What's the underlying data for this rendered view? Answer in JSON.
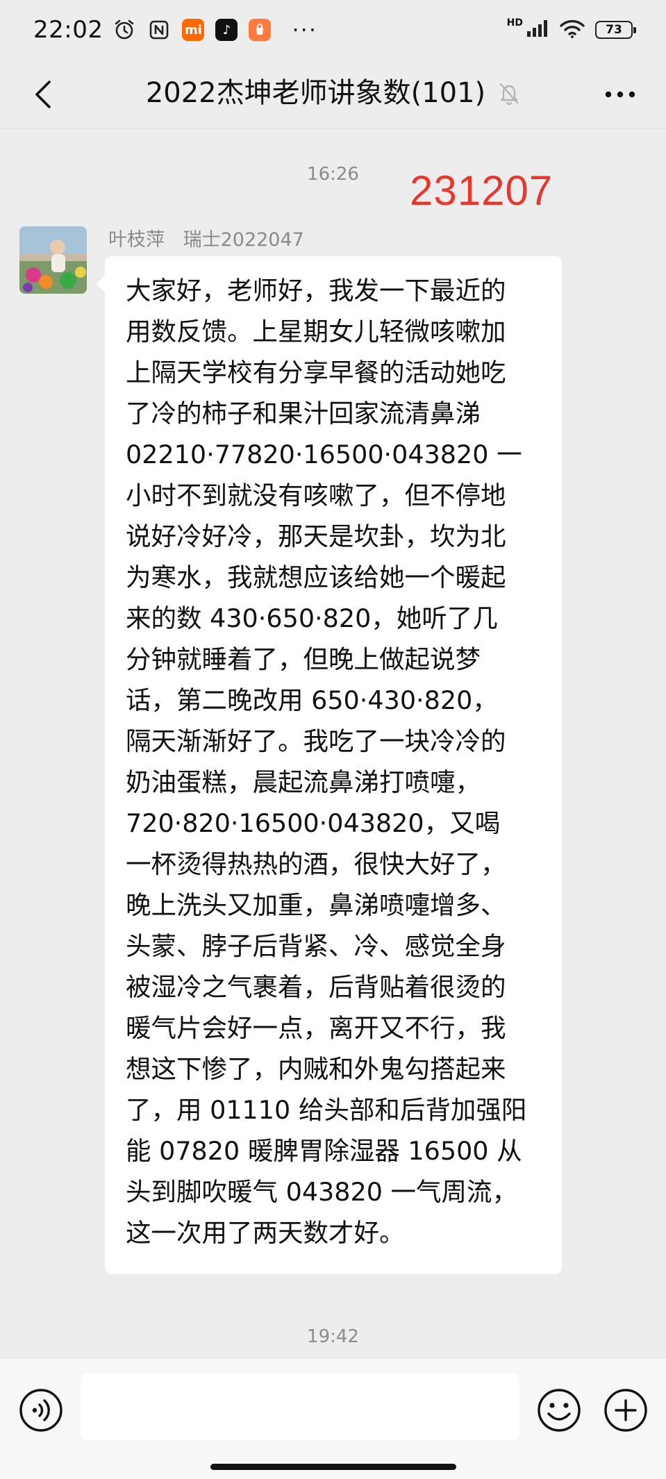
{
  "status_bar": {
    "time": "22:02",
    "app_badges": [
      {
        "name": "mi-app-icon",
        "text": "mi",
        "color": "#ff6900"
      },
      {
        "name": "tiktok-icon",
        "text": "♪",
        "color": "#111111"
      },
      {
        "name": "shopping-bag-icon",
        "text": "",
        "color": "#ff7a3d"
      }
    ],
    "more_dots": "···",
    "network_label": "HD",
    "battery_level": "73"
  },
  "header": {
    "title": "2022杰坤老师讲象数(101)",
    "muted_icon": "bell-off-icon",
    "back_icon": "chevron-left-icon",
    "more_icon": "more-dots-icon"
  },
  "chat": {
    "timestamp_top": "16:26",
    "overlay_number": "231207",
    "overlay_color": "#e8372d",
    "message": {
      "sender_name": "叶枝萍",
      "sender_tag": "瑞士2022047",
      "text": "大家好，老师好，我发一下最近的\n用数反馈。上星期女儿轻微咳嗽加\n上隔天学校有分享早餐的活动她吃\n了冷的柿子和果汁回家流清鼻涕\n02210·77820·16500·043820 一\n小时不到就没有咳嗽了，但不停地\n说好冷好冷，那天是坎卦，坎为北\n为寒水，我就想应该给她一个暖起\n来的数 430·650·820，她听了几\n分钟就睡着了，但晚上做起说梦\n话，第二晚改用 650·430·820，\n隔天渐渐好了。我吃了一块冷冷的\n奶油蛋糕，晨起流鼻涕打喷嚏，\n720·820·16500·043820，又喝\n一杯烫得热热的酒，很快大好了，\n晚上洗头又加重，鼻涕喷嚏增多、\n头蒙、脖子后背紧、冷、感觉全身\n被湿冷之气裹着，后背贴着很烫的\n暖气片会好一点，离开又不行，我\n想这下惨了，内贼和外鬼勾搭起来\n了，用 01110 给头部和后背加强阳\n能 07820 暖脾胃除湿器 16500 从\n头到脚吹暖气 043820 一气周流，\n这一次用了两天数才好。"
    },
    "timestamp_bottom": "19:42"
  },
  "input_bar": {
    "voice_icon": "voice-icon",
    "emoji_icon": "emoji-icon",
    "plus_icon": "plus-icon",
    "input_value": ""
  }
}
